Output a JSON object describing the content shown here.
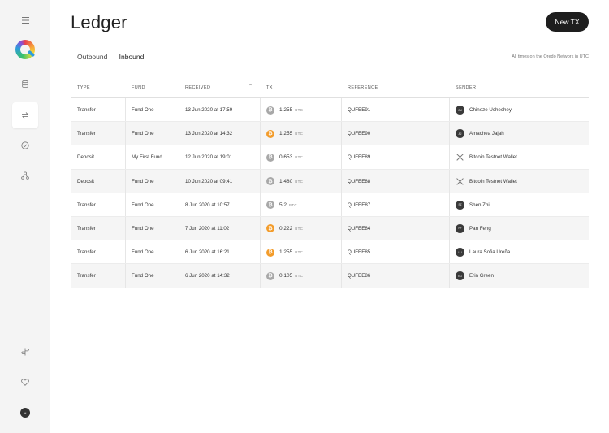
{
  "colors": {
    "btc_orange": "#f39c2b",
    "btc_grey": "#a8a8a8",
    "primary_button": "#1e1e1e"
  },
  "sidebar": {
    "icons": [
      "menu-icon",
      "logo",
      "database-icon",
      "transfer-icon",
      "check-circle-icon",
      "network-icon",
      "signpost-icon",
      "heart-icon",
      "user-avatar"
    ],
    "avatar_initials": "H"
  },
  "header": {
    "title": "Ledger",
    "new_tx_label": "New TX"
  },
  "tabs": [
    {
      "label": "Outbound",
      "active": false
    },
    {
      "label": "Inbound",
      "active": true
    }
  ],
  "timezone_note": "All times on the Qredo Network in UTC",
  "table": {
    "columns": [
      "TYPE",
      "FUND",
      "RECEIVED",
      "TX",
      "REFERENCE",
      "SENDER"
    ],
    "rows": [
      {
        "type": "Transfer",
        "fund": "Fund One",
        "received": "13 Jun 2020 at 17:59",
        "coin": "grey",
        "amount": "1.255",
        "unit": "BTC",
        "reference": "QUFEE91",
        "sender_kind": "user",
        "sender_initials": "CU",
        "sender": "Chineze Uchechey"
      },
      {
        "type": "Transfer",
        "fund": "Fund One",
        "received": "13 Jun 2020 at 14:32",
        "coin": "orange",
        "amount": "1.255",
        "unit": "BTC",
        "reference": "QUFEE90",
        "sender_kind": "user",
        "sender_initials": "AJ",
        "sender": "Amachea Jajah"
      },
      {
        "type": "Deposit",
        "fund": "My First Fund",
        "received": "12 Jun 2020 at 19:01",
        "coin": "grey",
        "amount": "0.653",
        "unit": "BTC",
        "reference": "QUFEE89",
        "sender_kind": "wallet",
        "sender_initials": "",
        "sender": "Bitcoin Testnet Wallet"
      },
      {
        "type": "Deposit",
        "fund": "Fund One",
        "received": "10 Jun 2020 at 09:41",
        "coin": "grey",
        "amount": "1.480",
        "unit": "BTC",
        "reference": "QUFEE88",
        "sender_kind": "wallet",
        "sender_initials": "",
        "sender": "Bitcoin Testnet Wallet"
      },
      {
        "type": "Transfer",
        "fund": "Fund One",
        "received": "8 Jun 2020 at 10:57",
        "coin": "grey",
        "amount": "5.2",
        "unit": "BTC",
        "reference": "QUFEE87",
        "sender_kind": "user",
        "sender_initials": "SZ",
        "sender": "Shen Zhi"
      },
      {
        "type": "Transfer",
        "fund": "Fund One",
        "received": "7 Jun 2020 at 11:02",
        "coin": "orange",
        "amount": "0.222",
        "unit": "BTC",
        "reference": "QUFEE84",
        "sender_kind": "user",
        "sender_initials": "PF",
        "sender": "Pan Feng"
      },
      {
        "type": "Transfer",
        "fund": "Fund One",
        "received": "6 Jun 2020 at 16:21",
        "coin": "orange",
        "amount": "1.255",
        "unit": "BTC",
        "reference": "QUFEE85",
        "sender_kind": "user",
        "sender_initials": "LU",
        "sender": "Laura Sofia Ureña"
      },
      {
        "type": "Transfer",
        "fund": "Fund One",
        "received": "6 Jun 2020 at 14:32",
        "coin": "grey",
        "amount": "0.105",
        "unit": "BTC",
        "reference": "QUFEE86",
        "sender_kind": "user",
        "sender_initials": "EG",
        "sender": "Erin Green"
      }
    ]
  }
}
